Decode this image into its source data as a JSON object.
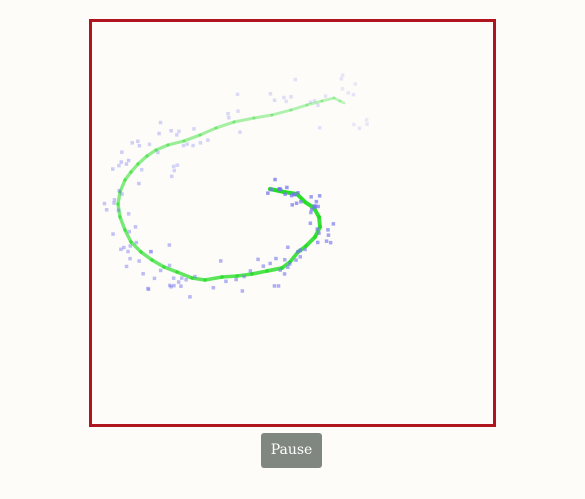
{
  "controls": {
    "pause_label": "Pause"
  },
  "colors": {
    "frame_border": "#b0151f",
    "background": "#fdfcf9",
    "trail": "#22dd22",
    "particles": "#7777ee",
    "button_bg": "#808680",
    "button_text": "#ffffff"
  }
}
